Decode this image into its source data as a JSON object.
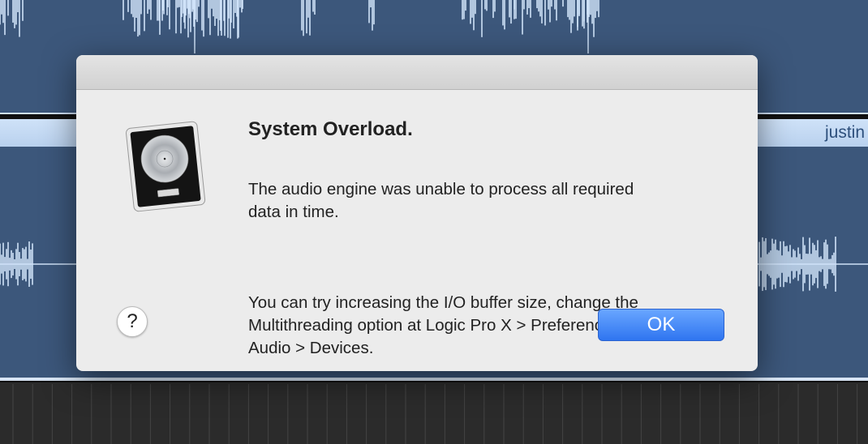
{
  "track": {
    "region_name": "justin"
  },
  "dialog": {
    "title": "System Overload.",
    "message_1": "The audio engine was unable to process all required\ndata in time.",
    "message_2": "You can try increasing the I/O buffer size, change the\nMultithreading option at Logic Pro X > Preferences >\nAudio > Devices.",
    "help_label": "?",
    "ok_label": "OK",
    "icon": "logic-pro-x-app-icon"
  },
  "colors": {
    "track_bg": "#3c577b",
    "waveform": "#cfe2f8",
    "ok_button": "#3a7ff5",
    "dialog_bg": "#ececec"
  }
}
